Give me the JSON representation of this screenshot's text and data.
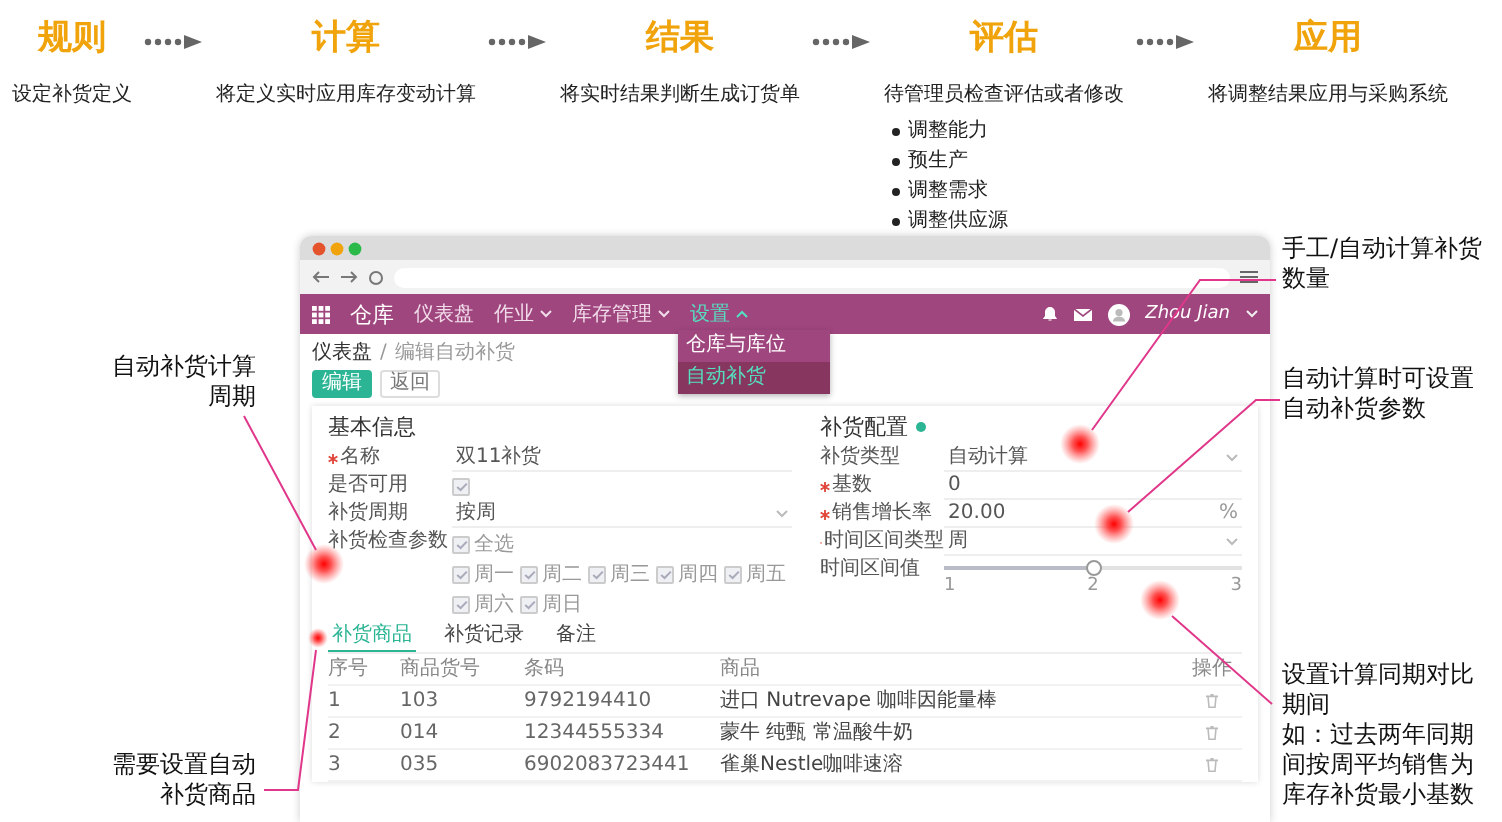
{
  "steps": [
    {
      "title": "规则",
      "description": "设定补货定义"
    },
    {
      "title": "计算",
      "description": "将定义实时应用库存变动计算"
    },
    {
      "title": "结果",
      "description": "将实时结果判断生成订货单"
    },
    {
      "title": "评估",
      "description": "待管理员检查评估或者修改",
      "bullets": [
        "调整能力",
        "预生产",
        "调整需求",
        "调整供应源"
      ]
    },
    {
      "title": "应用",
      "description": "将调整结果应用与采购系统"
    }
  ],
  "browser": {
    "nav": {
      "app": "仓库",
      "menu": [
        {
          "label": "仪表盘",
          "caret": false,
          "selected": false
        },
        {
          "label": "作业",
          "caret": true,
          "selected": false
        },
        {
          "label": "库存管理",
          "caret": true,
          "selected": false
        },
        {
          "label": "设置",
          "caret": true,
          "selected": true
        }
      ],
      "user": "Zhou Jian"
    },
    "dropdown": [
      {
        "label": "仓库与库位",
        "selected": false
      },
      {
        "label": "自动补货",
        "selected": true
      }
    ],
    "breadcrumb": [
      "仪表盘",
      "编辑自动补货"
    ],
    "breadcrumb_separator": "/",
    "buttons": [
      {
        "label": "编辑",
        "kind": "primary"
      },
      {
        "label": "返回",
        "kind": "plain"
      }
    ],
    "basic_info": {
      "title": "基本信息",
      "fields": [
        {
          "label": "名称",
          "required": true,
          "kind": "text",
          "value": "双11补货"
        },
        {
          "label": "是否可用",
          "required": false,
          "kind": "checkbox",
          "checked": true
        },
        {
          "label": "补货周期",
          "required": false,
          "kind": "select",
          "value": "按周"
        },
        {
          "label": "补货检查参数",
          "required": false,
          "kind": "checkgroup",
          "select_all": {
            "label": "全选",
            "checked": true
          },
          "items": [
            {
              "label": "周一",
              "checked": true
            },
            {
              "label": "周二",
              "checked": true
            },
            {
              "label": "周三",
              "checked": true
            },
            {
              "label": "周四",
              "checked": true
            },
            {
              "label": "周五",
              "checked": true
            },
            {
              "label": "周六",
              "checked": true
            },
            {
              "label": "周日",
              "checked": true
            }
          ]
        }
      ]
    },
    "config": {
      "title": "补货配置",
      "fields": [
        {
          "label": "补货类型",
          "required": false,
          "kind": "select",
          "value": "自动计算"
        },
        {
          "label": "基数",
          "required": true,
          "kind": "text",
          "value": "0"
        },
        {
          "label": "销售增长率",
          "required": true,
          "kind": "text",
          "value": "20.00",
          "suffix": "%"
        },
        {
          "label": "时间区间类型",
          "required": true,
          "kind": "select",
          "value": "周"
        },
        {
          "label": "时间区间值",
          "required": false,
          "kind": "slider",
          "level": 0.5,
          "ticks": [
            "1",
            "2",
            "3"
          ]
        }
      ]
    },
    "tabs": [
      {
        "label": "补货商品",
        "selected": true
      },
      {
        "label": "补货记录",
        "selected": false
      },
      {
        "label": "备注",
        "selected": false
      }
    ],
    "table": {
      "columns": [
        "序号",
        "商品货号",
        "条码",
        "商品",
        "操作"
      ],
      "rows": [
        [
          "1",
          "103",
          "9792194410",
          "进口 Nutrevape 咖啡因能量棒"
        ],
        [
          "2",
          "014",
          "12344555334",
          "蒙牛 纯甄 常温酸牛奶"
        ],
        [
          "3",
          "035",
          "6902083723441",
          "雀巢Nestle咖啡速溶"
        ]
      ]
    }
  },
  "left_callouts": [
    {
      "paragraphs": [
        "自动补货计算周期"
      ]
    },
    {
      "paragraphs": [
        "需要设置自动补货商品"
      ]
    }
  ],
  "right_callouts": [
    {
      "paragraphs": [
        "手工/自动计算补货数量"
      ]
    },
    {
      "paragraphs": [
        "自动计算时可设置自动补货参数"
      ]
    },
    {
      "paragraphs": [
        "设置计算同期对比期间",
        "如：过去两年同期间按周平均销售为库存补货最小基数"
      ]
    }
  ]
}
